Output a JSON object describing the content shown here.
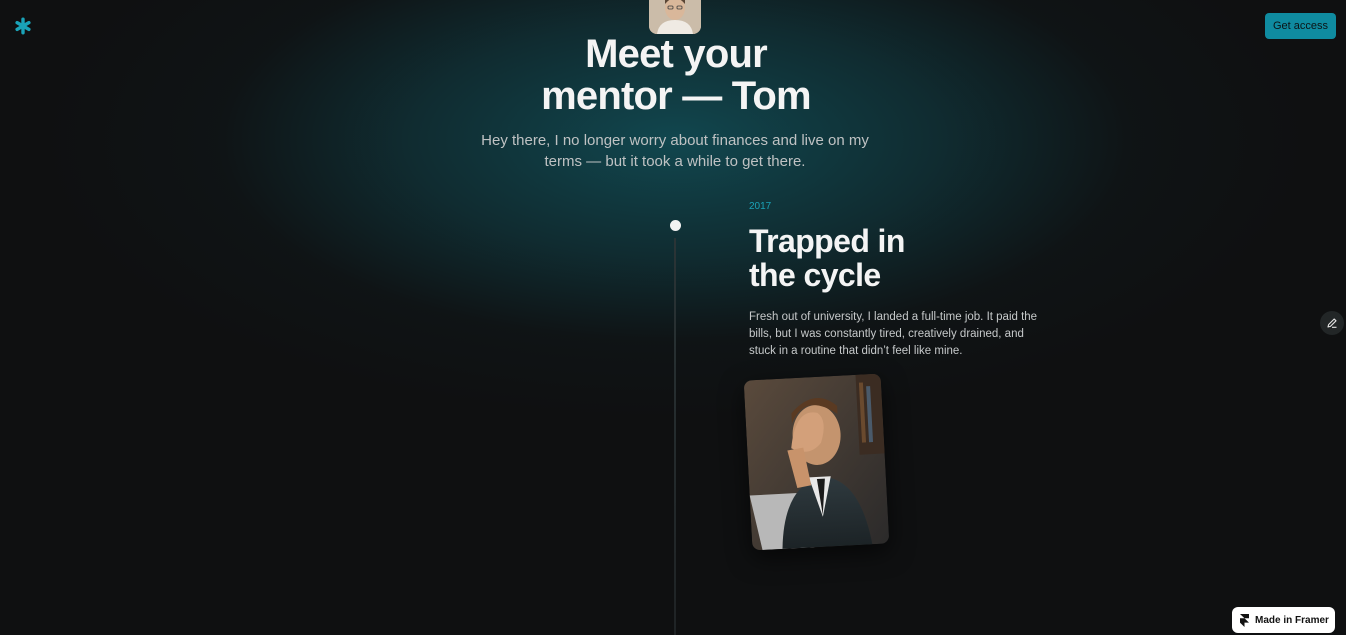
{
  "header": {
    "logo_icon": "asterisk-logo-icon",
    "cta_label": "Get access",
    "accent_color": "#0f8ba0"
  },
  "hero": {
    "title_line1": "Meet your",
    "title_line2": "mentor — Tom",
    "subtitle": "Hey there, I no longer worry about finances and live on my terms — but it took a while to get there."
  },
  "timeline": {
    "entries": [
      {
        "year": "2017",
        "title_line1": "Trapped in",
        "title_line2": "the cycle",
        "body": "Fresh out of university, I landed a full-time job. It paid the bills, but I was constantly tired, creatively drained, and stuck in a routine that didn’t feel like mine."
      }
    ]
  },
  "floating": {
    "edit_icon": "pencil-icon",
    "badge_label": "Made in Framer",
    "badge_icon": "framer-logo-icon"
  }
}
